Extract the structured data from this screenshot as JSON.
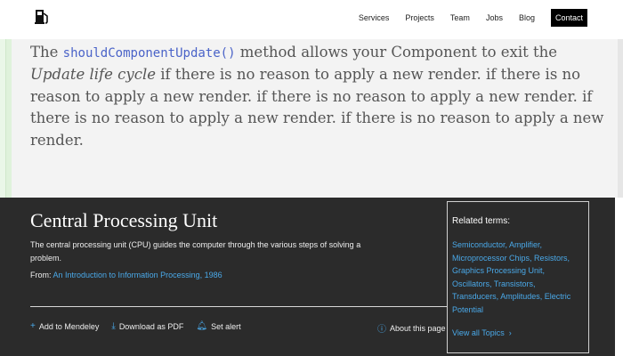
{
  "header": {
    "nav": [
      "Services",
      "Projects",
      "Team",
      "Jobs",
      "Blog"
    ],
    "contact_label": "Contact"
  },
  "quote": {
    "the": "The",
    "code": "shouldComponentUpdate()",
    "middle": "method allows your Component to exit the",
    "emphasis": "Update life cycle",
    "rest": "if there is no reason to apply a new render. if there is no reason to apply a new render. if there is no reason to apply a new render. if there is no reason to apply a new render. if there is no reason to apply a new render."
  },
  "panel": {
    "title": "Central Processing Unit",
    "description": "The central processing unit (CPU) guides the computer through the various steps of solving a problem.",
    "from_label": "From:",
    "from_link": "An Introduction to Information Processing, 1986",
    "actions": {
      "mendeley": "Add to Mendeley",
      "pdf": "Download as PDF",
      "alert": "Set alert",
      "about": "About this page"
    }
  },
  "related": {
    "heading": "Related terms:",
    "terms": "Semiconductor, Amplifier, Microprocessor Chips, Resistors, Graphics Processing Unit, Oscillators, Transistors, Transducers, Amplitudes, Electric Potential",
    "view_all": "View all Topics"
  },
  "colors": {
    "link": "#4aa9e9",
    "panel_bg": "#2b2b2b",
    "code": "#4a63c8",
    "quote_bar": "#dff2db"
  }
}
